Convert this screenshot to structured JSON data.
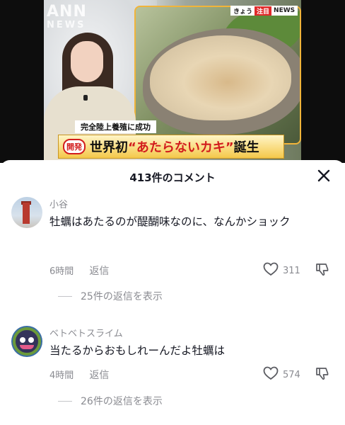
{
  "video": {
    "logo": "ANN",
    "logo_sub": "NEWS",
    "news_tag_prefix": "きょう",
    "news_tag_live": "注目",
    "news_tag": "NEWS",
    "caption_small": "完全陸上養殖に成功",
    "badge": "開発",
    "headline_pre": "世界初",
    "headline_quote": "“あたらないカキ”",
    "headline_post": "誕生"
  },
  "sheet": {
    "title": "413件のコメント"
  },
  "comments": [
    {
      "user": "小谷",
      "text": "牡蠣はあたるのが醍醐味なのに、なんかショック",
      "time": "6時間",
      "reply_label": "返信",
      "likes": "311",
      "view_replies": "25件の返信を表示"
    },
    {
      "user": "ベトベトスライム",
      "text": "当たるからおもしれーんだよ牡蠣は",
      "time": "4時間",
      "reply_label": "返信",
      "likes": "574",
      "view_replies": "26件の返信を表示"
    }
  ]
}
